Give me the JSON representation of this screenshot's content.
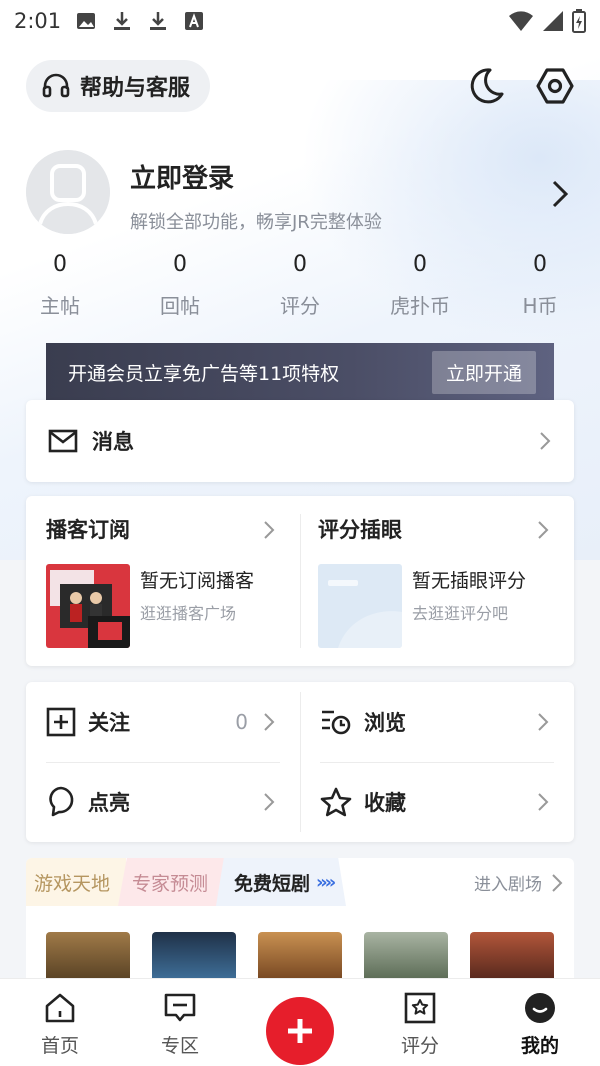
{
  "status_bar": {
    "time": "2:01"
  },
  "header": {
    "help_label": "帮助与客服"
  },
  "profile": {
    "login_title": "立即登录",
    "login_subtitle": "解锁全部功能，畅享JR完整体验"
  },
  "stats": [
    {
      "value": "0",
      "label": "主帖"
    },
    {
      "value": "0",
      "label": "回帖"
    },
    {
      "value": "0",
      "label": "评分"
    },
    {
      "value": "0",
      "label": "虎扑币"
    },
    {
      "value": "0",
      "label": "H币"
    }
  ],
  "vip": {
    "text": "开通会员立享免广告等11项特权",
    "button": "立即开通"
  },
  "messages": {
    "label": "消息"
  },
  "podcast": {
    "title": "播客订阅",
    "empty": "暂无订阅播客",
    "link": "逛逛播客广场"
  },
  "rating": {
    "title": "评分插眼",
    "empty": "暂无插眼评分",
    "link": "去逛逛评分吧"
  },
  "grid": {
    "follow": {
      "label": "关注",
      "count": "0"
    },
    "browse": {
      "label": "浏览"
    },
    "light": {
      "label": "点亮"
    },
    "collect": {
      "label": "收藏"
    }
  },
  "strip": {
    "tabs": [
      "游戏天地",
      "专家预测",
      "免费短剧"
    ],
    "enter": "进入剧场"
  },
  "bottom_nav": [
    {
      "label": "首页",
      "icon": "home-icon"
    },
    {
      "label": "专区",
      "icon": "chat-icon"
    },
    {
      "label": "",
      "icon": "plus-icon"
    },
    {
      "label": "评分",
      "icon": "star-box-icon"
    },
    {
      "label": "我的",
      "icon": "profile-icon"
    }
  ],
  "colors": {
    "accent_red": "#e61e2b",
    "vip_bg": "#3a3d4f",
    "link_blue": "#3a6fe0"
  }
}
